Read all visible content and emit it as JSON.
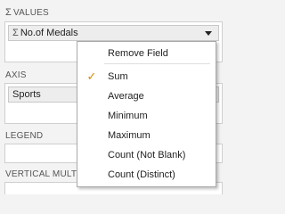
{
  "values_section": {
    "header": "VALUES",
    "sigma": "Σ",
    "field_sigma": "Σ",
    "field_label": "No.of Medals"
  },
  "axis_section": {
    "header": "AXIS",
    "field_label": "Sports"
  },
  "legend_section": {
    "header": "LEGEND"
  },
  "vertical_multiples_section": {
    "header": "VERTICAL MULTI"
  },
  "context_menu": {
    "remove_field": "Remove Field",
    "items": [
      "Sum",
      "Average",
      "Minimum",
      "Maximum",
      "Count (Not Blank)",
      "Count (Distinct)"
    ],
    "selected_item": "Sum",
    "check_glyph": "✓"
  },
  "colors": {
    "check": "#d18a00",
    "panel_bg": "#f3f3f3"
  }
}
